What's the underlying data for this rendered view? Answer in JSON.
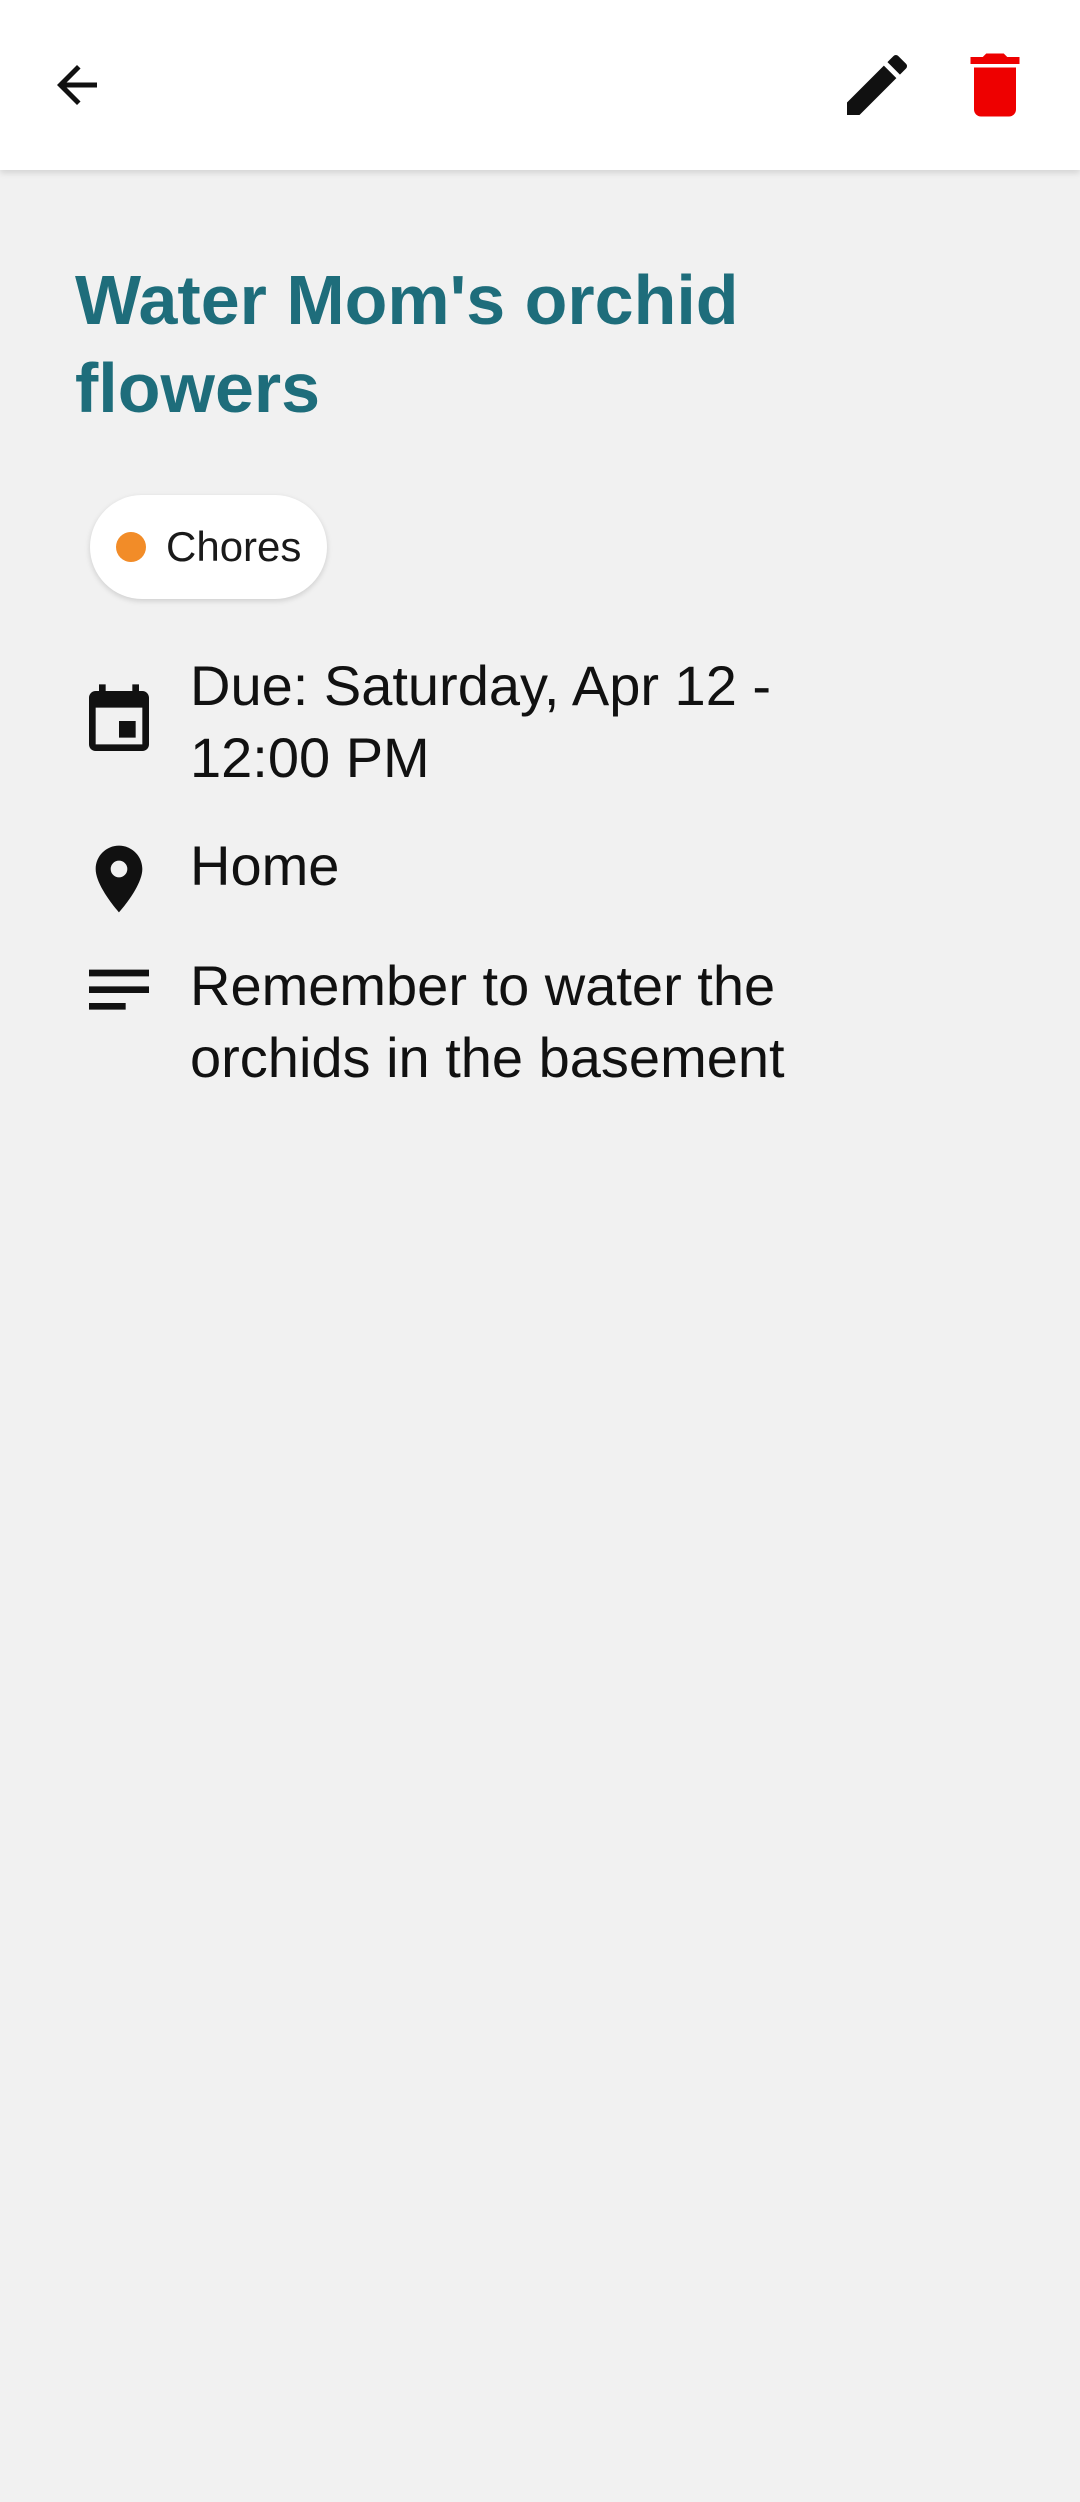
{
  "app_bar": {
    "back_icon": "arrow-back-icon",
    "edit_icon": "pencil-icon",
    "delete_icon": "trash-icon",
    "delete_color": "#ee0000"
  },
  "task": {
    "title": "Water Mom's orchid flowers",
    "title_color": "#1e6d7b",
    "category": {
      "label": "Chores",
      "color": "#f28c28"
    },
    "due": {
      "icon": "calendar-icon",
      "text": "Due: Saturday, Apr 12 - 12:00 PM"
    },
    "location": {
      "icon": "location-pin-icon",
      "text": "Home"
    },
    "notes": {
      "icon": "notes-icon",
      "text": "Remember to water the orchids in the basement"
    }
  }
}
